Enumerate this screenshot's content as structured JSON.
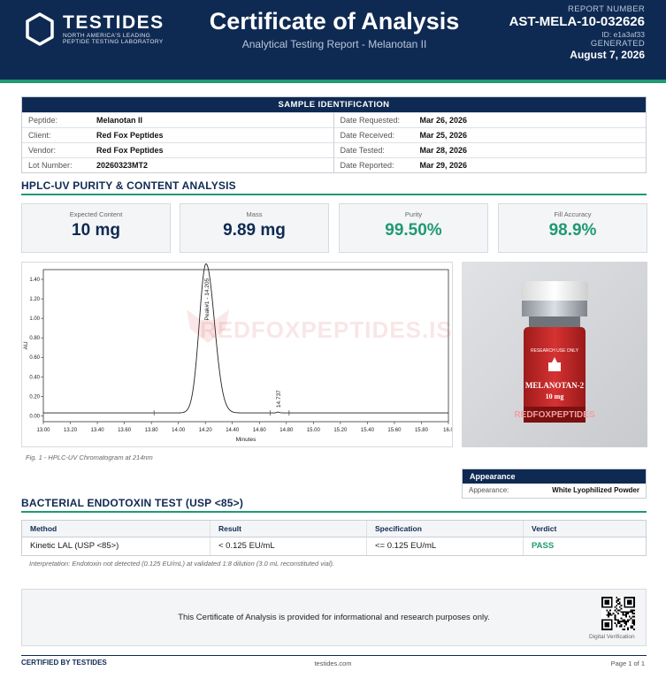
{
  "header": {
    "brand_name": "TESTIDES",
    "brand_tag_line1": "NORTH AMERICA'S LEADING",
    "brand_tag_line2": "PEPTIDE TESTING LABORATORY",
    "title": "Certificate of Analysis",
    "subtitle": "Analytical Testing Report  -  Melanotan II",
    "report_number_label": "REPORT NUMBER",
    "report_number": "AST-MELA-10-032626",
    "report_id": "ID: e1a3af33",
    "generated_label": "GENERATED",
    "generated_date": "August 7, 2026"
  },
  "sample": {
    "heading": "SAMPLE IDENTIFICATION",
    "left": [
      {
        "label": "Peptide:",
        "value": "Melanotan II"
      },
      {
        "label": "Client:",
        "value": "Red Fox Peptides"
      },
      {
        "label": "Vendor:",
        "value": "Red Fox Peptides"
      },
      {
        "label": "Lot Number:",
        "value": "20260323MT2"
      }
    ],
    "right": [
      {
        "label": "Date Requested:",
        "value": "Mar 26, 2026"
      },
      {
        "label": "Date Received:",
        "value": "Mar 25, 2026"
      },
      {
        "label": "Date Tested:",
        "value": "Mar 28, 2026"
      },
      {
        "label": "Date Reported:",
        "value": "Mar 29, 2026"
      }
    ]
  },
  "hplc": {
    "section_title": "HPLC-UV PURITY & CONTENT ANALYSIS",
    "metrics": [
      {
        "label": "Expected Content",
        "value": "10 mg"
      },
      {
        "label": "Mass",
        "value": "9.89 mg"
      },
      {
        "label": "Purity",
        "value": "99.50%"
      },
      {
        "label": "Fill Accuracy",
        "value": "98.9%"
      }
    ],
    "figure_caption": "Fig. 1  -  HPLC-UV Chromatogram at 214nm",
    "watermark": "REDFOXPEPTIDES.IS"
  },
  "chart_data": {
    "type": "line",
    "title": "",
    "xlabel": "Minutes",
    "ylabel": "AU",
    "xlim": [
      13.0,
      16.0
    ],
    "ylim": [
      -0.06,
      1.5
    ],
    "x_ticks": [
      "13.00",
      "13.20",
      "13.40",
      "13.60",
      "13.80",
      "14.00",
      "14.20",
      "14.40",
      "14.60",
      "14.80",
      "15.00",
      "15.20",
      "15.40",
      "15.60",
      "15.80",
      "16.0"
    ],
    "y_ticks": [
      "0.00",
      "0.20",
      "0.40",
      "0.60",
      "0.80",
      "1.00",
      "1.20",
      "1.40"
    ],
    "peaks": [
      {
        "label": "Peak#1 - 14.205",
        "rt": 14.205,
        "height": 1.53,
        "width": 0.05
      },
      {
        "label": "14.737",
        "rt": 14.737,
        "height": 0.008,
        "width": 0.01
      }
    ],
    "baseline": 0.03,
    "integration_marks": [
      13.82,
      14.68,
      14.82
    ],
    "grid": false,
    "line_color": "#222222"
  },
  "photo": {
    "label_top": "RESEARCH USE ONLY",
    "product_name": "MELANOTAN-2",
    "dose": "10 mg",
    "band_text": "REDFOXPEPTIDES"
  },
  "appearance": {
    "heading": "Appearance",
    "label": "Appearance:",
    "value": "White Lyophilized Powder"
  },
  "endotoxin": {
    "section_title": "BACTERIAL ENDOTOXIN TEST (USP <85>)",
    "headers": [
      "Method",
      "Result",
      "Specification",
      "Verdict"
    ],
    "row": [
      "Kinetic LAL (USP <85>)",
      "< 0.125 EU/mL",
      "<= 0.125 EU/mL",
      "PASS"
    ],
    "interpretation": "Interpretation: Endotoxin not detected (0.125 EU/mL) at validated 1:8 dilution (3.0 mL reconstituted vial)."
  },
  "notice": {
    "text": "This Certificate of Analysis is provided for informational and research purposes only.",
    "qr_label": "Digital Verification"
  },
  "footer": {
    "left": "CERTIFIED BY TESTIDES",
    "center": "testides.com",
    "right": "Page 1 of 1"
  },
  "colors": {
    "navy": "#0f2a52",
    "green": "#1f9a72",
    "vial_red": "#c92a2a"
  }
}
